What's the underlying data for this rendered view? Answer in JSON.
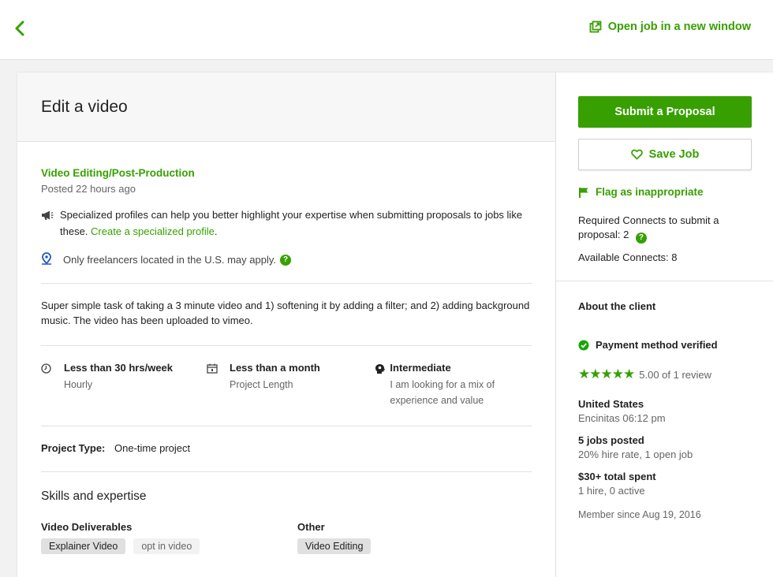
{
  "topbar": {
    "open_link_label": "Open job in a new window"
  },
  "job": {
    "title": "Edit a video",
    "category": "Video Editing/Post-Production",
    "posted": "Posted 22 hours ago",
    "specialized_note": "Specialized profiles can help you better highlight your expertise when submitting proposals to jobs like these.",
    "specialized_link": "Create a specialized profile",
    "location_note": "Only freelancers located in the U.S. may apply.",
    "description": "Super simple task of taking a 3 minute video and 1) softening it by adding a filter; and 2) adding background music. The video has been uploaded to vimeo.",
    "facts": [
      {
        "title": "Less than 30 hrs/week",
        "sub": "Hourly"
      },
      {
        "title": "Less than a month",
        "sub": "Project Length"
      },
      {
        "title": "Intermediate",
        "sub": "I am looking for a mix of experience and value"
      }
    ],
    "project_type_label": "Project Type:",
    "project_type_value": "One-time project",
    "skills_heading": "Skills and expertise",
    "skill_groups": [
      {
        "heading": "Video Deliverables",
        "chips": [
          "Explainer Video",
          "opt in video"
        ]
      },
      {
        "heading": "Other",
        "chips": [
          "Video Editing"
        ]
      }
    ]
  },
  "sidebar": {
    "submit_label": "Submit a Proposal",
    "save_label": "Save Job",
    "flag_label": "Flag as inappropriate",
    "connects_required": "Required Connects to submit a proposal: 2",
    "connects_available": "Available Connects: 8"
  },
  "client": {
    "heading": "About the client",
    "payment": "Payment method verified",
    "rating_text": "5.00 of 1 review",
    "rating_value": 5,
    "country": "United States",
    "city_time": "Encinitas 06:12 pm",
    "jobs_posted": "5 jobs posted",
    "hire_rate": "20% hire rate, 1 open job",
    "spent": "$30+ total spent",
    "hires": "1 hire, 0 active",
    "member_since": "Member since Aug 19, 2016"
  },
  "colors": {
    "accent": "#37a000",
    "help_icon": "#14a800",
    "location_icon": "#1f57c3"
  }
}
